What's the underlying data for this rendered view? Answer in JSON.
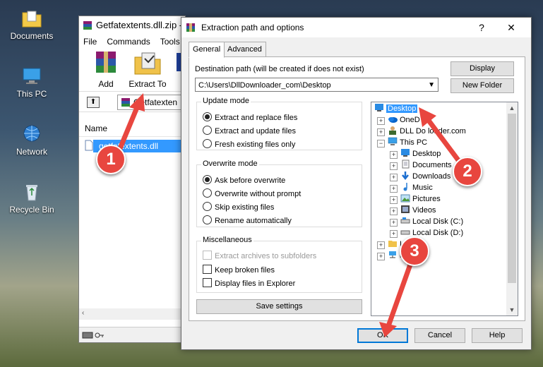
{
  "desktop": {
    "icons": [
      {
        "label": "Documents",
        "icon": "folder-icon"
      },
      {
        "label": "This PC",
        "icon": "computer-icon"
      },
      {
        "label": "Network",
        "icon": "network-icon"
      },
      {
        "label": "Recycle Bin",
        "icon": "recycle-bin-icon"
      }
    ]
  },
  "winrar": {
    "title": "Getfatextents.dll.zip -",
    "menu": [
      "File",
      "Commands",
      "Tools"
    ],
    "toolbar": {
      "add_label": "Add",
      "extract_label": "Extract To"
    },
    "address": "Getfatexten",
    "list_header": "Name",
    "file_row": "getfatextents.dll"
  },
  "dialog": {
    "title": "Extraction path and options",
    "help_glyph": "?",
    "close_glyph": "✕",
    "tabs": [
      "General",
      "Advanced"
    ],
    "destination_label": "Destination path (will be created if does not exist)",
    "destination_value": "C:\\Users\\DllDownloader_com\\Desktop",
    "display_button": "Display",
    "new_folder_button": "New Folder",
    "update_mode": {
      "title": "Update mode",
      "options": [
        "Extract and replace files",
        "Extract and update files",
        "Fresh existing files only"
      ],
      "selected": 0
    },
    "overwrite_mode": {
      "title": "Overwrite mode",
      "options": [
        "Ask before overwrite",
        "Overwrite without prompt",
        "Skip existing files",
        "Rename automatically"
      ],
      "selected": 0
    },
    "miscellaneous": {
      "title": "Miscellaneous",
      "options": [
        "Extract archives to subfolders",
        "Keep broken files",
        "Display files in Explorer"
      ]
    },
    "save_settings_button": "Save settings",
    "tree": [
      {
        "label": "Desktop",
        "icon": "desktop-icon",
        "selected": true
      },
      {
        "label": "OneD",
        "icon": "onedrive-icon"
      },
      {
        "label": "DLL Do   loader.com",
        "icon": "user-icon"
      },
      {
        "label": "This PC",
        "icon": "computer-icon"
      },
      {
        "label": "Desktop",
        "icon": "desktop-icon"
      },
      {
        "label": "Documents",
        "icon": "documents-icon"
      },
      {
        "label": "Downloads",
        "icon": "downloads-icon"
      },
      {
        "label": "Music",
        "icon": "music-icon"
      },
      {
        "label": "Pictures",
        "icon": "pictures-icon"
      },
      {
        "label": "Videos",
        "icon": "videos-icon"
      },
      {
        "label": "Local Disk (C:)",
        "icon": "drive-icon"
      },
      {
        "label": "Local Disk (D:)",
        "icon": "drive-icon"
      },
      {
        "label": "L",
        "icon": "libraries-icon"
      },
      {
        "label": "k",
        "icon": "network-icon"
      }
    ],
    "ok_button": "OK",
    "cancel_button": "Cancel",
    "help_button": "Help"
  },
  "annotations": [
    "1",
    "2",
    "3"
  ],
  "colors": {
    "accent": "#0078d7",
    "selection": "#3399ff",
    "arrow": "#e8463f"
  }
}
